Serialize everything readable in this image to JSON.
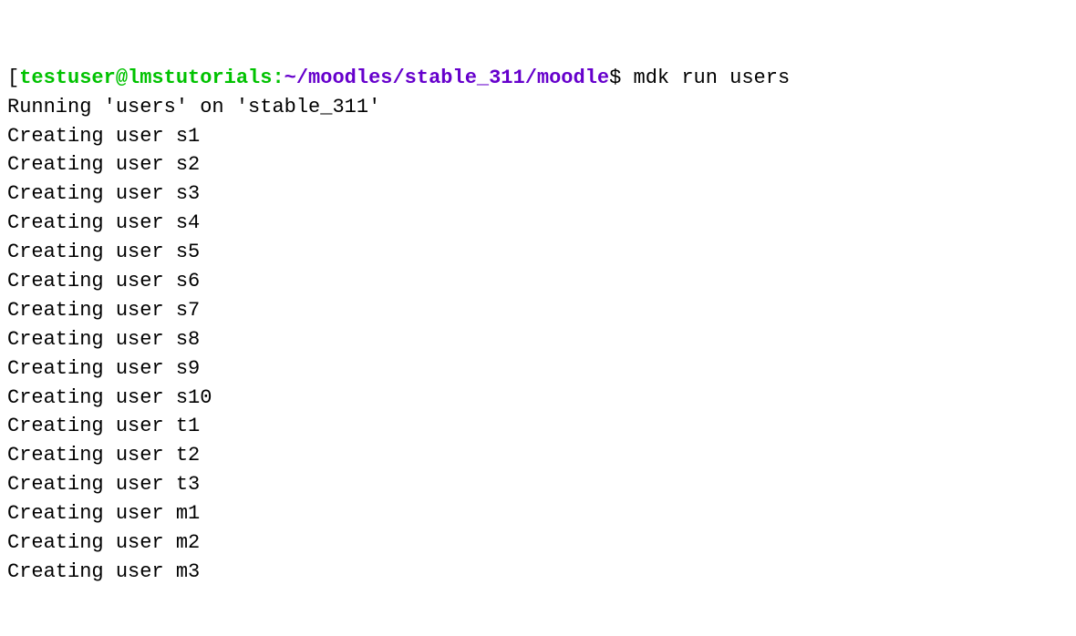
{
  "prompt": {
    "bracket_open": "[",
    "user_host": "testuser@lmstutorials",
    "colon": ":",
    "path": "~/moodles/stable_311/moodle",
    "dollar": "$ ",
    "command": "mdk run users"
  },
  "output": {
    "lines": [
      "Running 'users' on 'stable_311'",
      "Creating user s1",
      "Creating user s2",
      "Creating user s3",
      "Creating user s4",
      "Creating user s5",
      "Creating user s6",
      "Creating user s7",
      "Creating user s8",
      "Creating user s9",
      "Creating user s10",
      "Creating user t1",
      "Creating user t2",
      "Creating user t3",
      "Creating user m1",
      "Creating user m2",
      "Creating user m3"
    ]
  }
}
